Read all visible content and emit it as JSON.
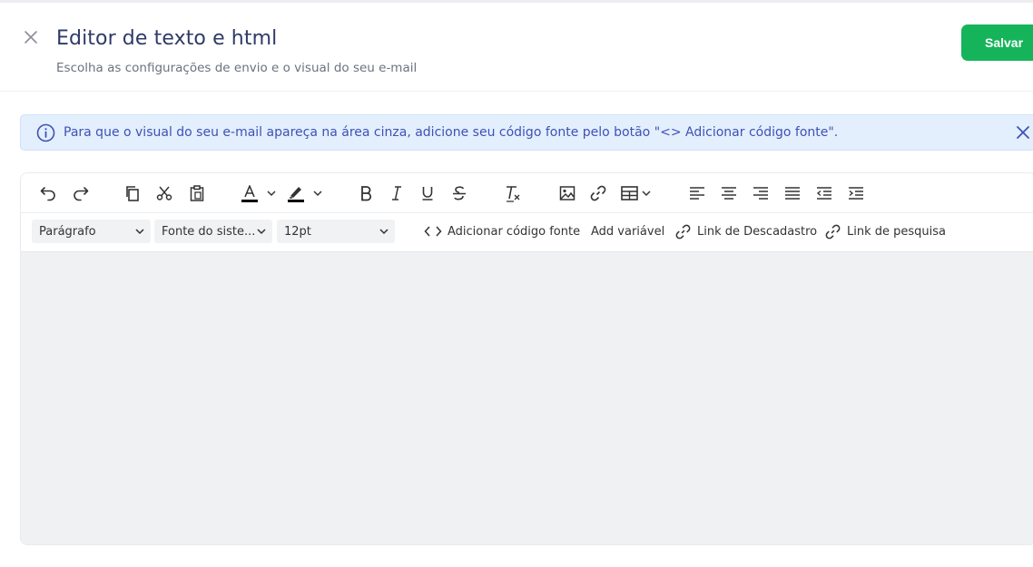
{
  "header": {
    "title": "Editor de texto e html",
    "subtitle": "Escolha as configurações de envio e o visual do seu e-mail",
    "save_label": "Salvar",
    "close_icon": "close-icon"
  },
  "alert": {
    "text": "Para que o visual do seu e-mail apareça na área cinza, adicione seu código fonte pelo botão \"<> Adicionar código fonte\".",
    "icon": "info-icon",
    "close_icon": "close-icon"
  },
  "toolbar": {
    "row1_icons": [
      "undo-icon",
      "redo-icon",
      "copy-icon",
      "cut-icon",
      "paste-icon",
      "text-color-icon",
      "highlight-color-icon",
      "bold-icon",
      "italic-icon",
      "underline-icon",
      "strikethrough-icon",
      "clear-formatting-icon",
      "image-icon",
      "link-icon",
      "table-icon",
      "align-left-icon",
      "align-center-icon",
      "align-right-icon",
      "align-justify-icon",
      "outdent-icon",
      "indent-icon"
    ],
    "block_format": "Parágrafo",
    "font_family": "Fonte do siste...",
    "font_size": "12pt",
    "add_source_code": "Adicionar código fonte",
    "add_variable": "Add variável",
    "unsubscribe_link": "Link de Descadastro",
    "survey_link": "Link de pesquisa"
  },
  "colors": {
    "primary_text": "#2f3a68",
    "save_button": "#16b45a",
    "alert_bg": "#e3effd",
    "alert_text": "#3f51b5",
    "editor_bg": "#f0f1f3"
  }
}
